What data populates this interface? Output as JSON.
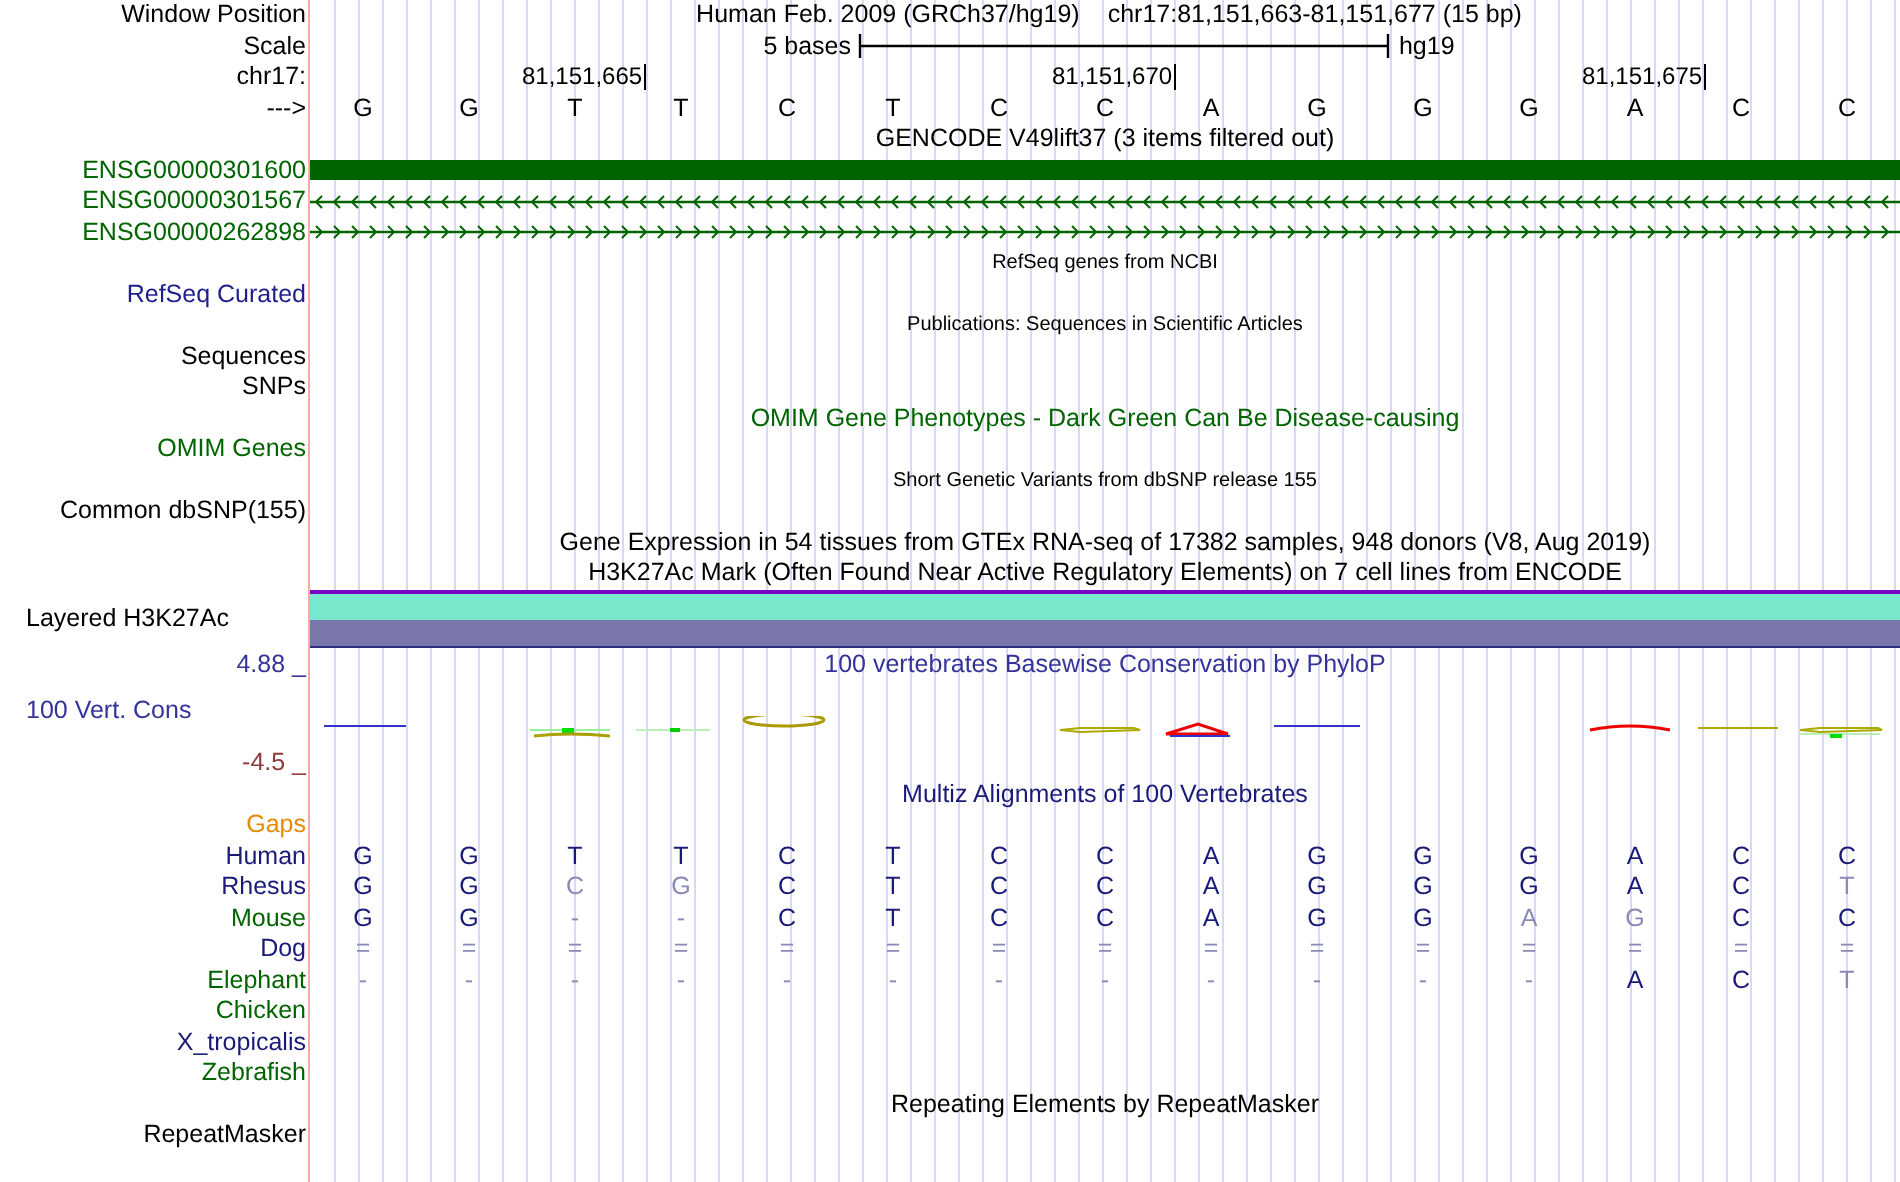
{
  "header": {
    "label": "Window Position",
    "assembly": "Human Feb. 2009 (GRCh37/hg19)",
    "position": "chr17:81,151,663-81,151,677 (15 bp)"
  },
  "scale": {
    "label": "Scale",
    "length": "5 bases",
    "assembly": "hg19"
  },
  "ruler": {
    "label": "chr17:",
    "strand_label": "--->",
    "bases": [
      {
        "base": "G"
      },
      {
        "base": "G"
      },
      {
        "base": "T",
        "tick": "81,151,665"
      },
      {
        "base": "T"
      },
      {
        "base": "C"
      },
      {
        "base": "T"
      },
      {
        "base": "C"
      },
      {
        "base": "C",
        "tick": "81,151,670"
      },
      {
        "base": "A"
      },
      {
        "base": "G"
      },
      {
        "base": "G"
      },
      {
        "base": "G"
      },
      {
        "base": "A",
        "tick": "81,151,675"
      },
      {
        "base": "C"
      },
      {
        "base": "C"
      }
    ]
  },
  "tracks": [
    {
      "kind": "heading",
      "title": "GENCODE V49lift37 (3 items filtered out)",
      "color": "#000000"
    },
    {
      "kind": "exon",
      "label": "ENSG00000301600",
      "color": "#006400"
    },
    {
      "kind": "minus",
      "label": "ENSG00000301567",
      "color": "#006400"
    },
    {
      "kind": "plus",
      "label": "ENSG00000262898",
      "color": "#006400"
    },
    {
      "kind": "note",
      "title": "RefSeq genes from NCBI",
      "color": "#000000"
    },
    {
      "kind": "label",
      "label": "RefSeq Curated",
      "color": "#1e1e8c"
    },
    {
      "kind": "note",
      "title": "Publications: Sequences in Scientific Articles",
      "color": "#000000"
    },
    {
      "kind": "label",
      "label": "Sequences",
      "color": "#000000"
    },
    {
      "kind": "label",
      "label": "SNPs",
      "color": "#000000"
    },
    {
      "kind": "heading",
      "title": "OMIM Gene Phenotypes - Dark Green Can Be Disease-causing",
      "color": "#006400"
    },
    {
      "kind": "label",
      "label": "OMIM Genes",
      "color": "#006400"
    },
    {
      "kind": "note",
      "title": "Short Genetic Variants from dbSNP release 155",
      "color": "#000000"
    },
    {
      "kind": "label",
      "label": "Common dbSNP(155)",
      "color": "#000000"
    },
    {
      "kind": "heading",
      "title": "Gene Expression in 54 tissues from GTEx RNA-seq of 17382 samples, 948 donors (V8, Aug 2019)",
      "color": "#000000"
    },
    {
      "kind": "heading",
      "title": "H3K27Ac Mark (Often Found Near Active Regulatory Elements) on 7 cell lines from ENCODE",
      "color": "#000000"
    },
    {
      "kind": "layered",
      "label": "Layered H3K27Ac",
      "color": "#000000"
    },
    {
      "kind": "axis",
      "label": "4.88 _",
      "color": "#333399",
      "title": "100 vertebrates Basewise Conservation by PhyloP"
    },
    {
      "kind": "wiggle",
      "label": "100 Vert. Cons",
      "color": "#333399"
    },
    {
      "kind": "axis",
      "label": "-4.5 _",
      "color": "#8b3a3a"
    },
    {
      "kind": "heading",
      "title": "Multiz Alignments of 100 Vertebrates",
      "color": "#1a1a78"
    },
    {
      "kind": "label",
      "label": "Gaps",
      "color": "#e68a00"
    },
    {
      "kind": "species",
      "label": "Human",
      "color": "#1a1a78",
      "bases": [
        {
          "base": "G",
          "faded": false
        },
        {
          "base": "G",
          "faded": false
        },
        {
          "base": "T",
          "faded": false
        },
        {
          "base": "T",
          "faded": false
        },
        {
          "base": "C",
          "faded": false
        },
        {
          "base": "T",
          "faded": false
        },
        {
          "base": "C",
          "faded": false
        },
        {
          "base": "C",
          "faded": false
        },
        {
          "base": "A",
          "faded": false
        },
        {
          "base": "G",
          "faded": false
        },
        {
          "base": "G",
          "faded": false
        },
        {
          "base": "G",
          "faded": false
        },
        {
          "base": "A",
          "faded": false
        },
        {
          "base": "C",
          "faded": false
        },
        {
          "base": "C",
          "faded": false
        }
      ]
    },
    {
      "kind": "species",
      "label": "Rhesus",
      "color": "#1a1a78",
      "bases": [
        {
          "base": "G",
          "faded": false
        },
        {
          "base": "G",
          "faded": false
        },
        {
          "base": "C",
          "faded": true
        },
        {
          "base": "G",
          "faded": true
        },
        {
          "base": "C",
          "faded": false
        },
        {
          "base": "T",
          "faded": false
        },
        {
          "base": "C",
          "faded": false
        },
        {
          "base": "C",
          "faded": false
        },
        {
          "base": "A",
          "faded": false
        },
        {
          "base": "G",
          "faded": false
        },
        {
          "base": "G",
          "faded": false
        },
        {
          "base": "G",
          "faded": false
        },
        {
          "base": "A",
          "faded": false
        },
        {
          "base": "C",
          "faded": false
        },
        {
          "base": "T",
          "faded": true
        }
      ]
    },
    {
      "kind": "species",
      "label": "Mouse",
      "color": "#006400",
      "bases": [
        {
          "base": "G",
          "faded": false
        },
        {
          "base": "G",
          "faded": false
        },
        {
          "base": "-",
          "faded": true
        },
        {
          "base": "-",
          "faded": true
        },
        {
          "base": "C",
          "faded": false
        },
        {
          "base": "T",
          "faded": false
        },
        {
          "base": "C",
          "faded": false
        },
        {
          "base": "C",
          "faded": false
        },
        {
          "base": "A",
          "faded": false
        },
        {
          "base": "G",
          "faded": false
        },
        {
          "base": "G",
          "faded": false
        },
        {
          "base": "A",
          "faded": true
        },
        {
          "base": "G",
          "faded": true
        },
        {
          "base": "C",
          "faded": false
        },
        {
          "base": "C",
          "faded": false
        }
      ]
    },
    {
      "kind": "species",
      "label": "Dog",
      "color": "#1a1a78",
      "bases": [
        {
          "base": "=",
          "faded": true
        },
        {
          "base": "=",
          "faded": true
        },
        {
          "base": "=",
          "faded": true
        },
        {
          "base": "=",
          "faded": true
        },
        {
          "base": "=",
          "faded": true
        },
        {
          "base": "=",
          "faded": true
        },
        {
          "base": "=",
          "faded": true
        },
        {
          "base": "=",
          "faded": true
        },
        {
          "base": "=",
          "faded": true
        },
        {
          "base": "=",
          "faded": true
        },
        {
          "base": "=",
          "faded": true
        },
        {
          "base": "=",
          "faded": true
        },
        {
          "base": "=",
          "faded": true
        },
        {
          "base": "=",
          "faded": true
        },
        {
          "base": "=",
          "faded": true
        }
      ]
    },
    {
      "kind": "species",
      "label": "Elephant",
      "color": "#006400",
      "bases": [
        {
          "base": "-",
          "faded": true
        },
        {
          "base": "-",
          "faded": true
        },
        {
          "base": "-",
          "faded": true
        },
        {
          "base": "-",
          "faded": true
        },
        {
          "base": "-",
          "faded": true
        },
        {
          "base": "-",
          "faded": true
        },
        {
          "base": "-",
          "faded": true
        },
        {
          "base": "-",
          "faded": true
        },
        {
          "base": "-",
          "faded": true
        },
        {
          "base": "-",
          "faded": true
        },
        {
          "base": "-",
          "faded": true
        },
        {
          "base": "-",
          "faded": true
        },
        {
          "base": "A",
          "faded": false
        },
        {
          "base": "C",
          "faded": false
        },
        {
          "base": "T",
          "faded": true
        }
      ]
    },
    {
      "kind": "label",
      "label": "Chicken",
      "color": "#006400"
    },
    {
      "kind": "label",
      "label": "X_tropicalis",
      "color": "#1a1a78"
    },
    {
      "kind": "label",
      "label": "Zebrafish",
      "color": "#006400"
    },
    {
      "kind": "heading",
      "title": "Repeating Elements by RepeatMasker",
      "color": "#000000"
    },
    {
      "kind": "label",
      "label": "RepeatMasker",
      "color": "#000000"
    }
  ]
}
